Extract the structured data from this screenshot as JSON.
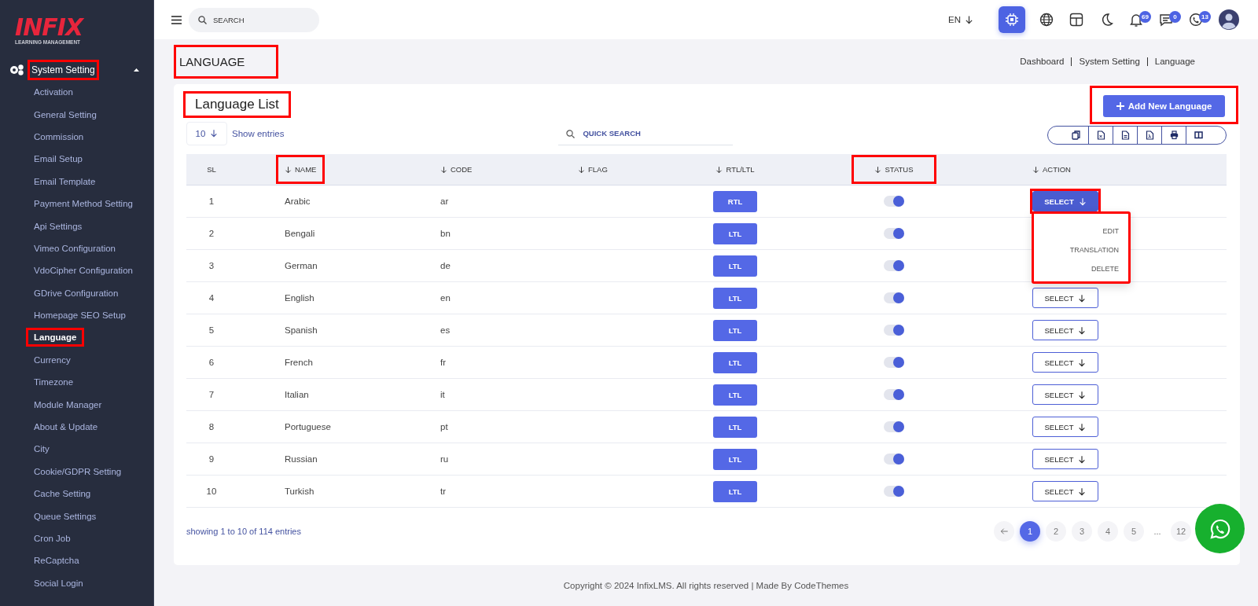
{
  "logo": {
    "title": "INFIX",
    "subtitle": "LEARNING MANAGEMENT"
  },
  "sidebar": {
    "section": {
      "label": "System Setting",
      "expanded": true,
      "highlighted": true
    },
    "items": [
      {
        "label": "Activation",
        "selected": false,
        "highlighted": false
      },
      {
        "label": "General Setting",
        "selected": false,
        "highlighted": false
      },
      {
        "label": "Commission",
        "selected": false,
        "highlighted": false
      },
      {
        "label": "Email Setup",
        "selected": false,
        "highlighted": false
      },
      {
        "label": "Email Template",
        "selected": false,
        "highlighted": false
      },
      {
        "label": "Payment Method Setting",
        "selected": false,
        "highlighted": false
      },
      {
        "label": "Api Settings",
        "selected": false,
        "highlighted": false
      },
      {
        "label": "Vimeo Configuration",
        "selected": false,
        "highlighted": false
      },
      {
        "label": "VdoCipher Configuration",
        "selected": false,
        "highlighted": false
      },
      {
        "label": "GDrive Configuration",
        "selected": false,
        "highlighted": false
      },
      {
        "label": "Homepage SEO Setup",
        "selected": false,
        "highlighted": false
      },
      {
        "label": "Language",
        "selected": true,
        "highlighted": true
      },
      {
        "label": "Currency",
        "selected": false,
        "highlighted": false
      },
      {
        "label": "Timezone",
        "selected": false,
        "highlighted": false
      },
      {
        "label": "Module Manager",
        "selected": false,
        "highlighted": false
      },
      {
        "label": "About & Update",
        "selected": false,
        "highlighted": false
      },
      {
        "label": "City",
        "selected": false,
        "highlighted": false
      },
      {
        "label": "Cookie/GDPR Setting",
        "selected": false,
        "highlighted": false
      },
      {
        "label": "Cache Setting",
        "selected": false,
        "highlighted": false
      },
      {
        "label": "Queue Settings",
        "selected": false,
        "highlighted": false
      },
      {
        "label": "Cron Job",
        "selected": false,
        "highlighted": false
      },
      {
        "label": "ReCaptcha",
        "selected": false,
        "highlighted": false
      },
      {
        "label": "Social Login",
        "selected": false,
        "highlighted": false
      }
    ]
  },
  "topbar": {
    "search": {
      "placeholder": "SEARCH"
    },
    "language": "EN",
    "icons": [
      {
        "kind": "ai",
        "selected": true
      },
      {
        "kind": "globe",
        "selected": false
      },
      {
        "kind": "layout",
        "selected": false
      },
      {
        "kind": "moon",
        "selected": false
      }
    ],
    "notifications": [
      {
        "kind": "bell",
        "count": "69"
      },
      {
        "kind": "chat",
        "count": "0"
      },
      {
        "kind": "phone",
        "count": "13"
      }
    ]
  },
  "page": {
    "title": "LANGUAGE",
    "highlighted": true,
    "breadcrumbs": [
      "Dashboard",
      "System Setting",
      "Language"
    ]
  },
  "card": {
    "title": "Language List",
    "highlighted": true,
    "add_button": {
      "label": "Add New Language",
      "highlighted": true
    },
    "page_size": "10",
    "show_entries": "Show entries",
    "search": {
      "placeholder": "QUICK SEARCH"
    },
    "export_buttons": [
      {
        "kind": "copy"
      },
      {
        "kind": "excel"
      },
      {
        "kind": "csv"
      },
      {
        "kind": "pdf"
      },
      {
        "kind": "print"
      },
      {
        "kind": "columns"
      }
    ]
  },
  "table": {
    "columns": [
      {
        "label": "SL",
        "sortable": false,
        "highlighted": false
      },
      {
        "label": "NAME",
        "sortable": true,
        "highlighted": true
      },
      {
        "label": "CODE",
        "sortable": true,
        "highlighted": false
      },
      {
        "label": "FLAG",
        "sortable": true,
        "highlighted": false
      },
      {
        "label": "RTL/LTL",
        "sortable": true,
        "highlighted": false
      },
      {
        "label": "STATUS",
        "sortable": true,
        "highlighted": true
      },
      {
        "label": "ACTION",
        "sortable": true,
        "highlighted": false
      }
    ],
    "rows": [
      {
        "sl": "1",
        "name": "Arabic",
        "code": "ar",
        "direction": "RTL",
        "status": true,
        "action": "SELECT",
        "menu_open": true
      },
      {
        "sl": "2",
        "name": "Bengali",
        "code": "bn",
        "direction": "LTL",
        "status": true
      },
      {
        "sl": "3",
        "name": "German",
        "code": "de",
        "direction": "LTL",
        "status": true
      },
      {
        "sl": "4",
        "name": "English",
        "code": "en",
        "direction": "LTL",
        "status": true,
        "action": "SELECT",
        "menu_open": false
      },
      {
        "sl": "5",
        "name": "Spanish",
        "code": "es",
        "direction": "LTL",
        "status": true,
        "action": "SELECT",
        "menu_open": false
      },
      {
        "sl": "6",
        "name": "French",
        "code": "fr",
        "direction": "LTL",
        "status": true,
        "action": "SELECT",
        "menu_open": false
      },
      {
        "sl": "7",
        "name": "Italian",
        "code": "it",
        "direction": "LTL",
        "status": true,
        "action": "SELECT",
        "menu_open": false
      },
      {
        "sl": "8",
        "name": "Portuguese",
        "code": "pt",
        "direction": "LTL",
        "status": true,
        "action": "SELECT",
        "menu_open": false
      },
      {
        "sl": "9",
        "name": "Russian",
        "code": "ru",
        "direction": "LTL",
        "status": true,
        "action": "SELECT",
        "menu_open": false
      },
      {
        "sl": "10",
        "name": "Turkish",
        "code": "tr",
        "direction": "LTL",
        "status": true,
        "action": "SELECT",
        "menu_open": false
      }
    ],
    "menu": {
      "highlighted": true,
      "items": [
        "EDIT",
        "TRANSLATION",
        "DELETE"
      ]
    }
  },
  "info": "showing 1 to 10 of 114 entries",
  "pagination": [
    {
      "kind": "prev"
    },
    {
      "kind": "page",
      "label": "1",
      "selected": true
    },
    {
      "kind": "page",
      "label": "2",
      "selected": false
    },
    {
      "kind": "page",
      "label": "3",
      "selected": false
    },
    {
      "kind": "page",
      "label": "4",
      "selected": false
    },
    {
      "kind": "page",
      "label": "5",
      "selected": false
    },
    {
      "kind": "gap",
      "label": "..."
    },
    {
      "kind": "page",
      "label": "12",
      "selected": false
    }
  ],
  "copyright": "Copyright © 2024 InfixLMS. All rights reserved | Made By CodeThemes"
}
